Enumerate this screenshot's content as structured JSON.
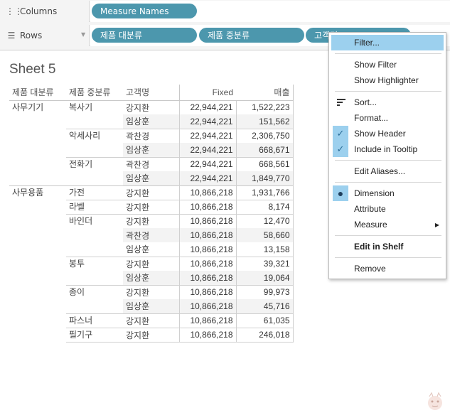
{
  "shelves": {
    "columns": {
      "label": "Columns",
      "pills": [
        "Measure Names"
      ]
    },
    "rows": {
      "label": "Rows",
      "pills": [
        "제품 대분류",
        "제품 중분류",
        "고객명"
      ]
    }
  },
  "sheet": {
    "title": "Sheet 5",
    "headers": [
      "제품 대분류",
      "제품 중분류",
      "고객명",
      "Fixed",
      "매출"
    ],
    "groups": [
      {
        "category": "사무기기",
        "subgroups": [
          {
            "name": "복사기",
            "rows": [
              {
                "customer": "강지환",
                "fixed": "22,944,221",
                "sales": "1,522,223"
              },
              {
                "customer": "임상훈",
                "fixed": "22,944,221",
                "sales": "151,562"
              }
            ]
          },
          {
            "name": "악세사리",
            "rows": [
              {
                "customer": "곽찬경",
                "fixed": "22,944,221",
                "sales": "2,306,750"
              },
              {
                "customer": "임상훈",
                "fixed": "22,944,221",
                "sales": "668,671"
              }
            ]
          },
          {
            "name": "전화기",
            "rows": [
              {
                "customer": "곽찬경",
                "fixed": "22,944,221",
                "sales": "668,561"
              },
              {
                "customer": "임상훈",
                "fixed": "22,944,221",
                "sales": "1,849,770"
              }
            ]
          }
        ]
      },
      {
        "category": "사무용품",
        "subgroups": [
          {
            "name": "가전",
            "rows": [
              {
                "customer": "강지환",
                "fixed": "10,866,218",
                "sales": "1,931,766"
              }
            ]
          },
          {
            "name": "라벨",
            "rows": [
              {
                "customer": "강지환",
                "fixed": "10,866,218",
                "sales": "8,174"
              }
            ]
          },
          {
            "name": "바인더",
            "rows": [
              {
                "customer": "강지환",
                "fixed": "10,866,218",
                "sales": "12,470"
              },
              {
                "customer": "곽찬경",
                "fixed": "10,866,218",
                "sales": "58,660"
              },
              {
                "customer": "임상훈",
                "fixed": "10,866,218",
                "sales": "13,158"
              }
            ]
          },
          {
            "name": "봉투",
            "rows": [
              {
                "customer": "강지환",
                "fixed": "10,866,218",
                "sales": "39,321"
              },
              {
                "customer": "임상훈",
                "fixed": "10,866,218",
                "sales": "19,064"
              }
            ]
          },
          {
            "name": "종이",
            "rows": [
              {
                "customer": "강지환",
                "fixed": "10,866,218",
                "sales": "99,973"
              },
              {
                "customer": "임상훈",
                "fixed": "10,866,218",
                "sales": "45,716"
              }
            ]
          },
          {
            "name": "파스너",
            "rows": [
              {
                "customer": "강지환",
                "fixed": "10,866,218",
                "sales": "61,035"
              }
            ]
          },
          {
            "name": "필기구",
            "rows": [
              {
                "customer": "강지환",
                "fixed": "10,866,218",
                "sales": "246,018"
              }
            ]
          }
        ]
      }
    ]
  },
  "context_menu": {
    "items": {
      "filter": "Filter...",
      "show_filter": "Show Filter",
      "show_highlighter": "Show Highlighter",
      "sort": "Sort...",
      "format": "Format...",
      "show_header": "Show Header",
      "include_in_tooltip": "Include in Tooltip",
      "edit_aliases": "Edit Aliases...",
      "dimension": "Dimension",
      "attribute": "Attribute",
      "measure": "Measure",
      "edit_in_shelf": "Edit in Shelf",
      "remove": "Remove"
    },
    "checked": [
      "show_header",
      "include_in_tooltip"
    ],
    "selected_role": "dimension",
    "highlighted": "filter"
  },
  "colors": {
    "pill": "#4c97ad",
    "menu_highlight": "#9cd0ee",
    "check": "#2b6e99"
  },
  "icons": [
    "columns-icon",
    "rows-icon",
    "sort-icon",
    "checkmark-icon",
    "bullet-icon",
    "submenu-arrow-icon"
  ]
}
